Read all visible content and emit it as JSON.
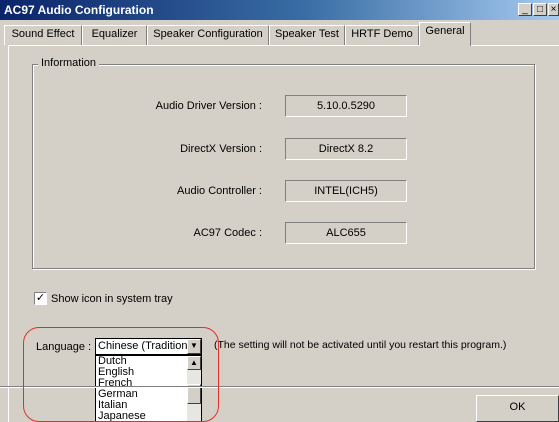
{
  "window": {
    "title": "AC97 Audio Configuration",
    "minimize_glyph": "_",
    "maximize_glyph": "□",
    "close_glyph": "×"
  },
  "tabs": [
    {
      "label": "Sound Effect"
    },
    {
      "label": "Equalizer"
    },
    {
      "label": "Speaker Configuration"
    },
    {
      "label": "Speaker Test"
    },
    {
      "label": "HRTF Demo"
    },
    {
      "label": "General",
      "active": true
    }
  ],
  "information": {
    "legend": "Information",
    "rows": [
      {
        "label": "Audio Driver Version :",
        "value": "5.10.0.5290"
      },
      {
        "label": "DirectX Version :",
        "value": "DirectX 8.2"
      },
      {
        "label": "Audio Controller :",
        "value": "INTEL(ICH5)"
      },
      {
        "label": "AC97 Codec :",
        "value": "ALC655"
      }
    ]
  },
  "tray": {
    "label": "Show icon in system tray",
    "checked": true,
    "check_glyph": "✓"
  },
  "language": {
    "label": "Language :",
    "selected": "Chinese (Traditional)",
    "note": "(The setting will not be activated until you restart this program.)",
    "options": [
      "Dutch",
      "English",
      "French",
      "German",
      "Italian",
      "Japanese"
    ]
  },
  "buttons": {
    "ok": "OK"
  },
  "icons": {
    "dropdown": "chevron-down-icon",
    "scroll_up": "arrow-up-icon",
    "check": "check-icon"
  },
  "colors": {
    "title_gradient_start": "#0a246a",
    "title_gradient_end": "#a6caf0",
    "face": "#d4d0c8",
    "annotation_ring": "#e0302a"
  }
}
